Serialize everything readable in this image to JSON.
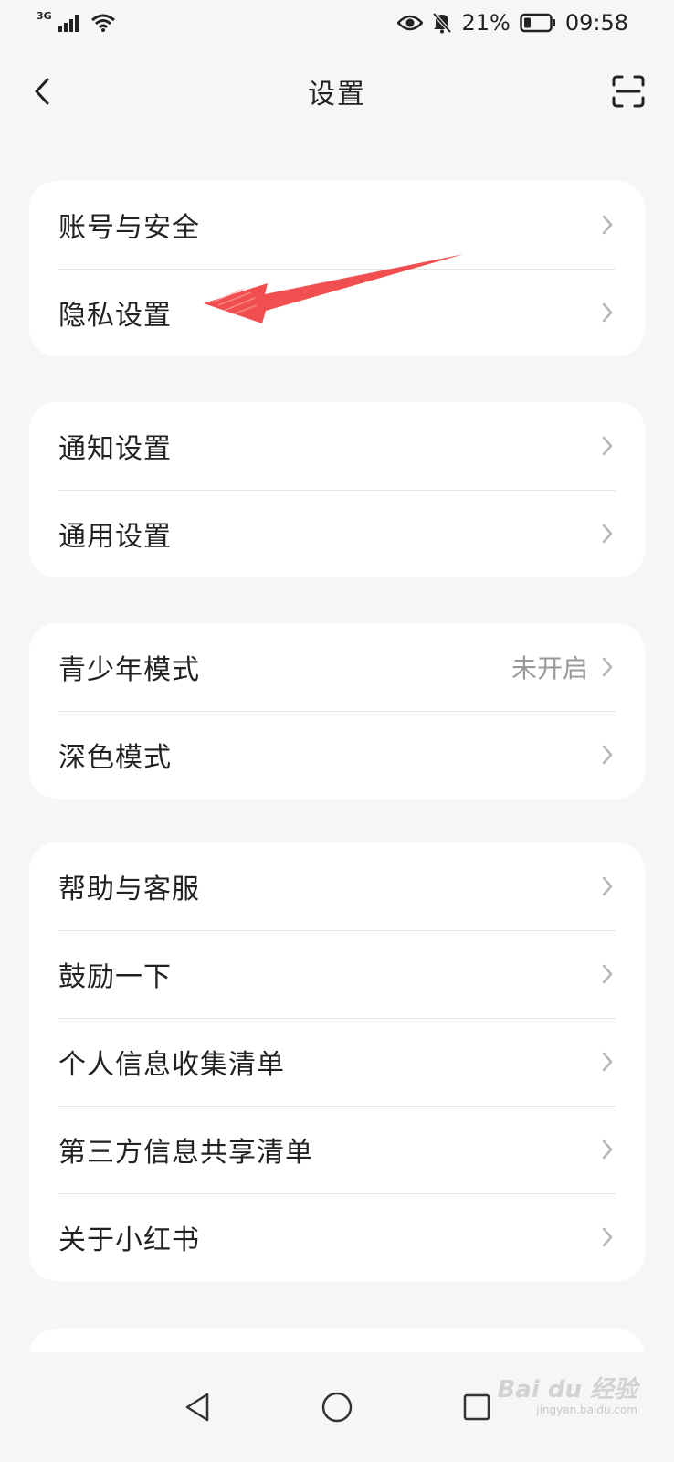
{
  "status_bar": {
    "network": "3G",
    "battery": "21%",
    "time": "09:58"
  },
  "header": {
    "title": "设置"
  },
  "groups": [
    {
      "items": [
        {
          "label": "账号与安全",
          "value": ""
        },
        {
          "label": "隐私设置",
          "value": ""
        }
      ]
    },
    {
      "items": [
        {
          "label": "通知设置",
          "value": ""
        },
        {
          "label": "通用设置",
          "value": ""
        }
      ]
    },
    {
      "items": [
        {
          "label": "青少年模式",
          "value": "未开启"
        },
        {
          "label": "深色模式",
          "value": ""
        }
      ]
    },
    {
      "items": [
        {
          "label": "帮助与客服",
          "value": ""
        },
        {
          "label": "鼓励一下",
          "value": ""
        },
        {
          "label": "个人信息收集清单",
          "value": ""
        },
        {
          "label": "第三方信息共享清单",
          "value": ""
        },
        {
          "label": "关于小红书",
          "value": ""
        }
      ]
    }
  ],
  "watermark": {
    "brand": "Bai du 经验",
    "url": "jingyan.baidu.com"
  },
  "colors": {
    "background": "#f6f6f6",
    "card": "#ffffff",
    "text": "#222222",
    "secondary_text": "#999999",
    "annotation_arrow": "#f04040"
  }
}
